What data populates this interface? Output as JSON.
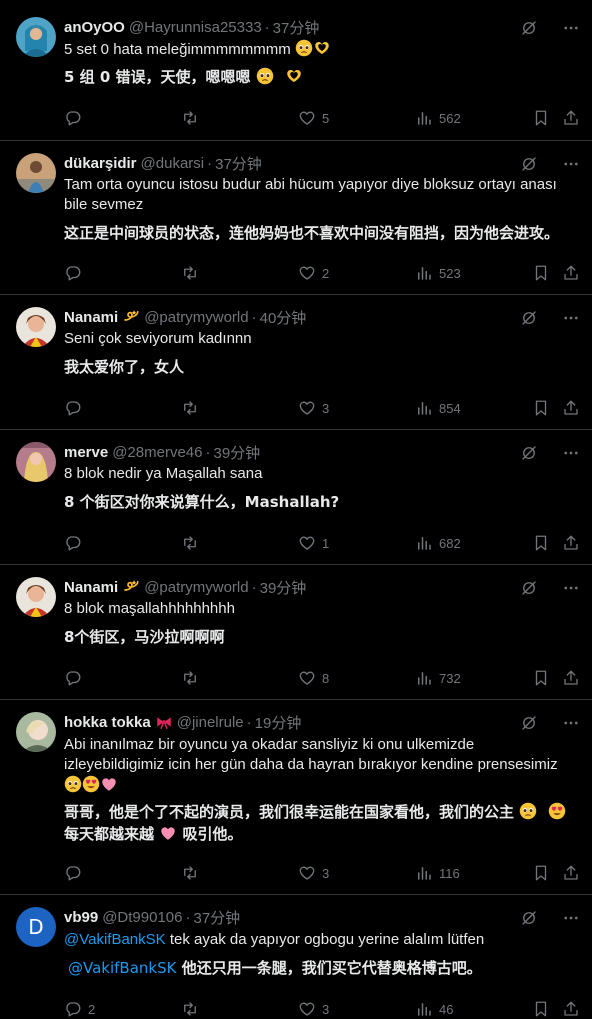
{
  "tweets": [
    {
      "name": "anOyOO",
      "handle": "@Hayrunnisa25333",
      "time": "37分钟",
      "text": "5 set 0 hata meleğimmmmmmmm",
      "translation": "5 组 0 错误，天使，嗯嗯嗯",
      "reply_count": "",
      "retweet_count": "",
      "like_count": "5",
      "view_count": "562",
      "text_emojis": [
        "pleading-face-emoji",
        "heart-hands-emoji"
      ],
      "translation_emojis": [
        "pleading-face-emoji",
        "heart-hands-emoji"
      ]
    },
    {
      "name": "dükarşidir",
      "handle": "@dukarsi",
      "time": "37分钟",
      "text": "Tam orta oyuncu istosu budur abi hücum yapıyor diye bloksuz ortayı anası bile sevmez",
      "translation": "这正是中间球员的状态，连他妈妈也不喜欢中间没有阻挡，因为他会进攻。",
      "reply_count": "",
      "retweet_count": "",
      "like_count": "2",
      "view_count": "523"
    },
    {
      "name": "Nanami",
      "handle": "@patrymyworld",
      "time": "40分钟",
      "text": "Seni çok seviyorum kadınnn",
      "translation": "我太爱你了，女人",
      "reply_count": "",
      "retweet_count": "",
      "like_count": "3",
      "view_count": "854"
    },
    {
      "name": "merve",
      "handle": "@28merve46",
      "time": "39分钟",
      "text": "8 blok nedir ya Maşallah sana",
      "translation": "8 个街区对你来说算什么，Mashallah?",
      "reply_count": "",
      "retweet_count": "",
      "like_count": "1",
      "view_count": "682"
    },
    {
      "name": "Nanami",
      "handle": "@patrymyworld",
      "time": "39分钟",
      "text": "8 blok maşallahhhhhhhhh",
      "translation": "8个街区，马沙拉啊啊啊",
      "reply_count": "",
      "retweet_count": "",
      "like_count": "8",
      "view_count": "732"
    },
    {
      "name": "hokka tokka",
      "handle": "@jinelrule",
      "time": "19分钟",
      "text": "Abi inanılmaz bir oyuncu ya okadar sansliyiz ki onu ulkemizde izleyebildigimiz icin her gün daha da hayran bırakıyor kendine prensesimiz",
      "translation_1": "哥哥，他是个了不起的演员，我们很幸运能在国家看他，我们的公主",
      "translation_2": "每天都越来越",
      "translation_3": "吸引他。",
      "reply_count": "",
      "retweet_count": "",
      "like_count": "3",
      "view_count": "116"
    },
    {
      "name": "vb99",
      "handle": "@Dt990106",
      "time": "37分钟",
      "avatar_letter": "D",
      "mention": "@VakifBankSK",
      "text": "tek ayak da yapıyor ogbogu yerine alalım lütfen",
      "translation": "他还只用一条腿，我们买它代替奥格博古吧。",
      "reply_count": "2",
      "retweet_count": "",
      "like_count": "3",
      "view_count": "46"
    }
  ],
  "colors": {
    "background": "#000000",
    "text": "#e7e9ea",
    "muted": "#71767b",
    "link": "#1d9bf0",
    "divider": "#2f3336"
  }
}
